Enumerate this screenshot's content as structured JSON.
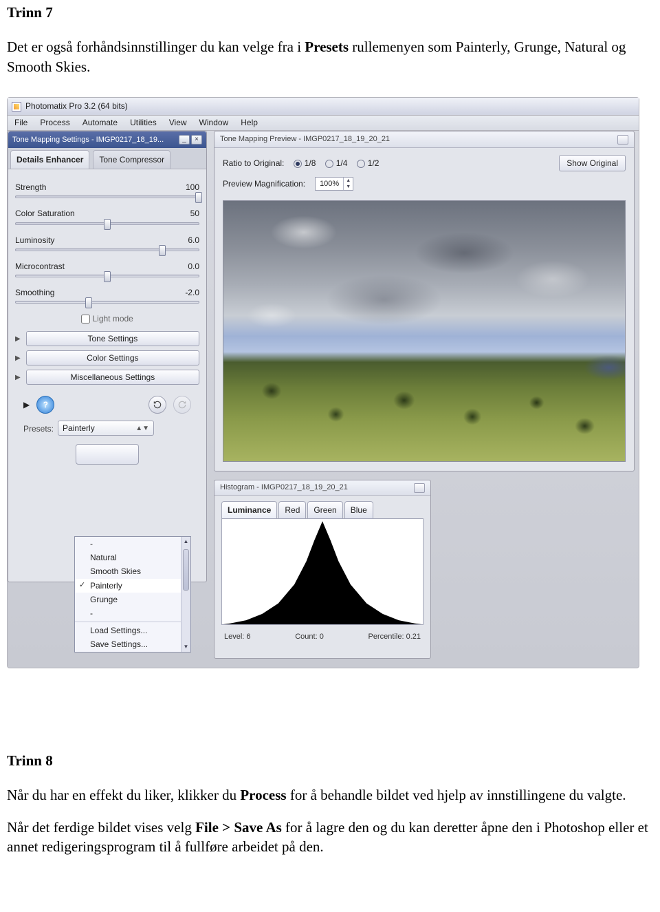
{
  "doc": {
    "step7_title": "Trinn 7",
    "step7_p1_a": "Det er også forhåndsinnstillinger du kan velge fra i ",
    "step7_p1_b": "Presets",
    "step7_p1_c": " rullemenyen som Painterly, Grunge, Natural og Smooth Skies.",
    "step8_title": "Trinn 8",
    "step8_p1_a": "Når du har en effekt du liker, klikker du ",
    "step8_p1_b": "Process",
    "step8_p1_c": " for å behandle bildet ved hjelp av innstillingene du valgte.",
    "step8_p2_a": "Når det ferdige bildet vises velg ",
    "step8_p2_b": "File > Save As",
    "step8_p2_c": " for å lagre den og du kan deretter åpne den i Photoshop eller et annet redigeringsprogram til å fullføre arbeidet på den."
  },
  "app": {
    "title": "Photomatix Pro 3.2 (64 bits)",
    "menu": [
      "File",
      "Process",
      "Automate",
      "Utilities",
      "View",
      "Window",
      "Help"
    ]
  },
  "settings": {
    "title": "Tone Mapping Settings - IMGP0217_18_19...",
    "tabs": {
      "active": "Details Enhancer",
      "inactive": "Tone Compressor"
    },
    "sliders": [
      {
        "label": "Strength",
        "value": "100",
        "pos": 100
      },
      {
        "label": "Color Saturation",
        "value": "50",
        "pos": 50
      },
      {
        "label": "Luminosity",
        "value": "6.0",
        "pos": 80
      },
      {
        "label": "Microcontrast",
        "value": "0.0",
        "pos": 50
      },
      {
        "label": "Smoothing",
        "value": "-2.0",
        "pos": 40
      }
    ],
    "light_mode": "Light mode",
    "groups": [
      "Tone Settings",
      "Color Settings",
      "Miscellaneous Settings"
    ],
    "presets_label": "Presets:",
    "preset_selected": "Painterly",
    "dropdown": [
      "-",
      "Natural",
      "Smooth Skies",
      "Painterly",
      "Grunge",
      "-",
      "Load Settings...",
      "Save Settings..."
    ]
  },
  "preview": {
    "title": "Tone Mapping Preview - IMGP0217_18_19_20_21",
    "ratio_label": "Ratio to Original:",
    "ratios": [
      "1/8",
      "1/4",
      "1/2"
    ],
    "ratio_selected": 0,
    "mag_label": "Preview Magnification:",
    "mag_value": "100%",
    "show_original": "Show Original"
  },
  "histogram": {
    "title": "Histogram - IMGP0217_18_19_20_21",
    "tabs": [
      "Luminance",
      "Red",
      "Green",
      "Blue"
    ],
    "level_label": "Level:",
    "level": "6",
    "count_label": "Count:",
    "count": "0",
    "pct_label": "Percentile:",
    "pct": "0.21"
  }
}
